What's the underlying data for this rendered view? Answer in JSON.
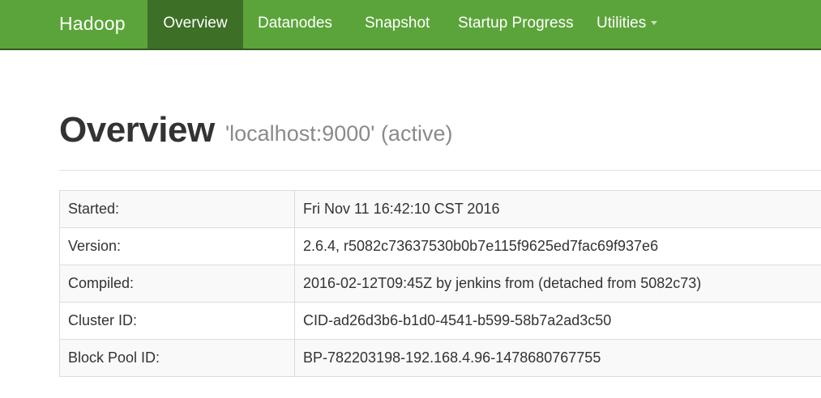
{
  "nav": {
    "brand": "Hadoop",
    "items": [
      {
        "label": "Overview"
      },
      {
        "label": "Datanodes"
      },
      {
        "label": "Snapshot"
      },
      {
        "label": "Startup Progress"
      },
      {
        "label": "Utilities"
      }
    ]
  },
  "header": {
    "title": "Overview",
    "subtitle": "'localhost:9000' (active)"
  },
  "info_rows": [
    {
      "label": "Started:",
      "value": "Fri Nov 11 16:42:10 CST 2016"
    },
    {
      "label": "Version:",
      "value": "2.6.4, r5082c73637530b0b7e115f9625ed7fac69f937e6"
    },
    {
      "label": "Compiled:",
      "value": "2016-02-12T09:45Z by jenkins from (detached from 5082c73)"
    },
    {
      "label": "Cluster ID:",
      "value": "CID-ad26d3b6-b1d0-4541-b599-58b7a2ad3c50"
    },
    {
      "label": "Block Pool ID:",
      "value": "BP-782203198-192.168.4.96-1478680767755"
    }
  ],
  "colors": {
    "navbar": "#5ba43a",
    "navbar_active": "#3d6f27",
    "navbar_border": "#2f5a1c"
  }
}
